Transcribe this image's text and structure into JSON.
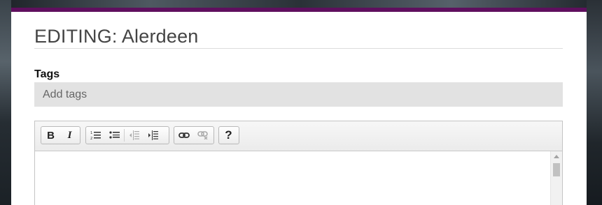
{
  "page": {
    "title": "EDITING: Alerdeen",
    "accent_color": "#5f0f5e"
  },
  "tags": {
    "label": "Tags",
    "placeholder": "Add tags",
    "value": ""
  },
  "editor": {
    "content": "",
    "toolbar": [
      {
        "group": "formatting",
        "buttons": [
          {
            "name": "bold-button",
            "label": "B"
          },
          {
            "name": "italic-button",
            "label": "I"
          }
        ]
      },
      {
        "group": "lists",
        "buttons": [
          {
            "name": "numbered-list-button",
            "icon": "ordered-list-icon"
          },
          {
            "name": "bullet-list-button",
            "icon": "unordered-list-icon"
          },
          {
            "name": "outdent-button",
            "icon": "outdent-icon",
            "disabled": true
          },
          {
            "name": "indent-button",
            "icon": "indent-icon"
          }
        ]
      },
      {
        "group": "links",
        "buttons": [
          {
            "name": "link-button",
            "icon": "link-icon"
          },
          {
            "name": "unlink-button",
            "icon": "unlink-icon",
            "disabled": true
          }
        ]
      },
      {
        "group": "help",
        "buttons": [
          {
            "name": "help-button",
            "label": "?"
          }
        ]
      }
    ]
  }
}
